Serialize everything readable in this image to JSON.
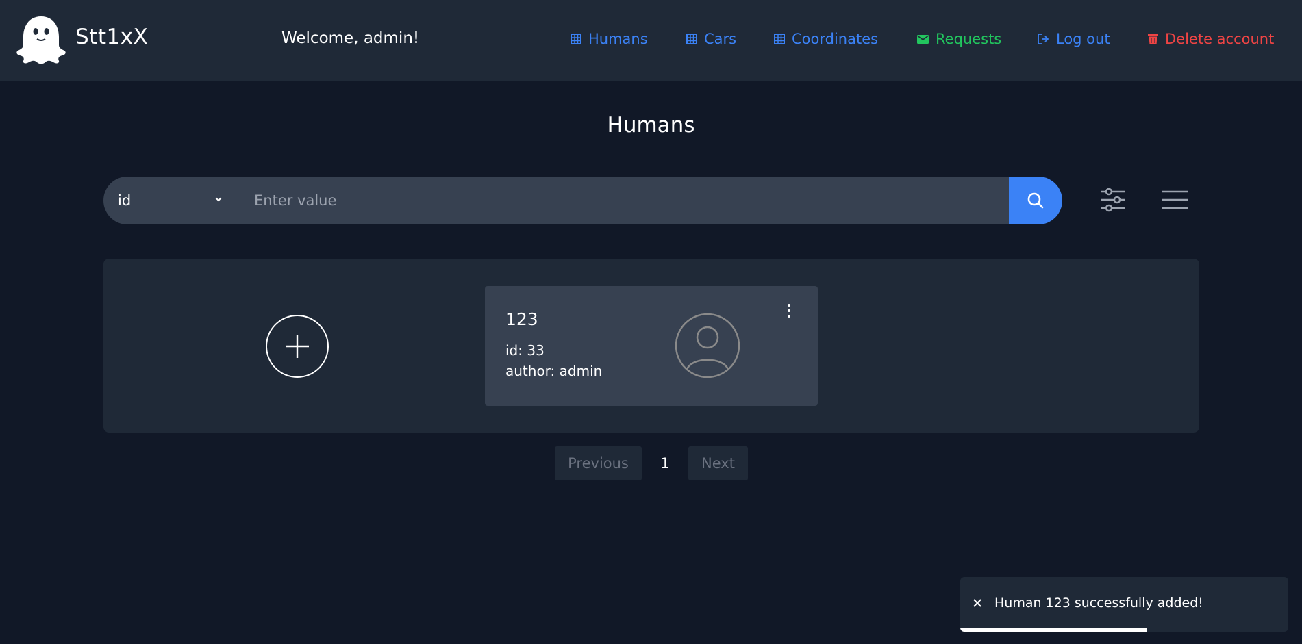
{
  "header": {
    "brand": "Stt1xX",
    "welcome": "Welcome, admin!",
    "nav": [
      {
        "label": "Humans",
        "icon": "grid-icon",
        "color": "#3b82f6"
      },
      {
        "label": "Cars",
        "icon": "grid-icon",
        "color": "#3b82f6"
      },
      {
        "label": "Coordinates",
        "icon": "grid-icon",
        "color": "#3b82f6"
      },
      {
        "label": "Requests",
        "icon": "mail-icon",
        "color": "#22c55e"
      },
      {
        "label": "Log out",
        "icon": "logout-icon",
        "color": "#3b82f6"
      },
      {
        "label": "Delete account",
        "icon": "trash-icon",
        "color": "#ef4444"
      }
    ]
  },
  "page": {
    "title": "Humans"
  },
  "search": {
    "field": "id",
    "placeholder": "Enter value",
    "value": ""
  },
  "cards": [
    {
      "name": "123",
      "id_line": "id: 33",
      "author_line": "author: admin"
    }
  ],
  "pagination": {
    "previous": "Previous",
    "current": "1",
    "next": "Next"
  },
  "toast": {
    "message": "Human 123 successfully added!",
    "progress": 0.57
  },
  "colors": {
    "background": "#111827",
    "header": "#1f2937",
    "accent": "#3b82f6",
    "success": "#22c55e",
    "danger": "#ef4444"
  }
}
